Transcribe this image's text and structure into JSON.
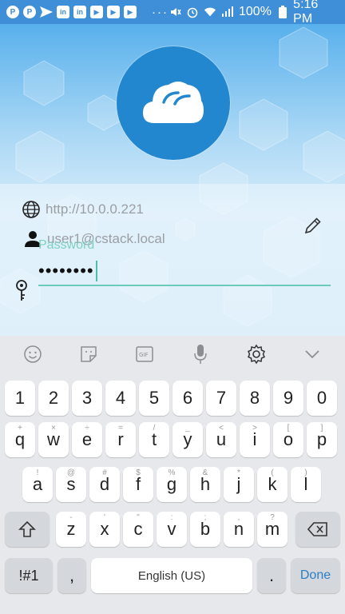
{
  "status_bar": {
    "battery": "100%",
    "time": "5:16 PM",
    "more": "···",
    "left_icons": [
      "pinterest-icon",
      "pinterest-icon",
      "send-icon",
      "linkedin-icon",
      "linkedin-icon",
      "youtube-icon",
      "youtube-icon",
      "youtube-icon"
    ],
    "right_icons": [
      "mute-icon",
      "alarm-icon",
      "wifi-icon",
      "signal-icon",
      "battery-icon"
    ]
  },
  "login": {
    "server_url": "http://10.0.0.221",
    "username": "user1@cstack.local",
    "password_label": "Password",
    "password_value": "••••••••"
  },
  "keyboard": {
    "toolbar": [
      "emoji-icon",
      "sticker-icon",
      "gif-icon",
      "mic-icon",
      "settings-icon",
      "collapse-icon"
    ],
    "number_row": [
      "1",
      "2",
      "3",
      "4",
      "5",
      "6",
      "7",
      "8",
      "9",
      "0"
    ],
    "row1": [
      "q",
      "w",
      "e",
      "r",
      "t",
      "y",
      "u",
      "i",
      "o",
      "p"
    ],
    "row1_hints": [
      "+",
      "×",
      "÷",
      "=",
      "/",
      "_",
      "<",
      ">",
      "[",
      "]"
    ],
    "row2": [
      "a",
      "s",
      "d",
      "f",
      "g",
      "h",
      "j",
      "k",
      "l"
    ],
    "row2_hints": [
      "!",
      "@",
      "#",
      "$",
      "%",
      "&",
      "*",
      "(",
      ")"
    ],
    "row3": [
      "z",
      "x",
      "c",
      "v",
      "b",
      "n",
      "m"
    ],
    "row3_hints": [
      "-",
      "'",
      "\"",
      ":",
      ";",
      ",",
      "?"
    ],
    "sym_label": "!#1",
    "comma": ",",
    "space_label": "English (US)",
    "period": ".",
    "done_label": "Done"
  }
}
